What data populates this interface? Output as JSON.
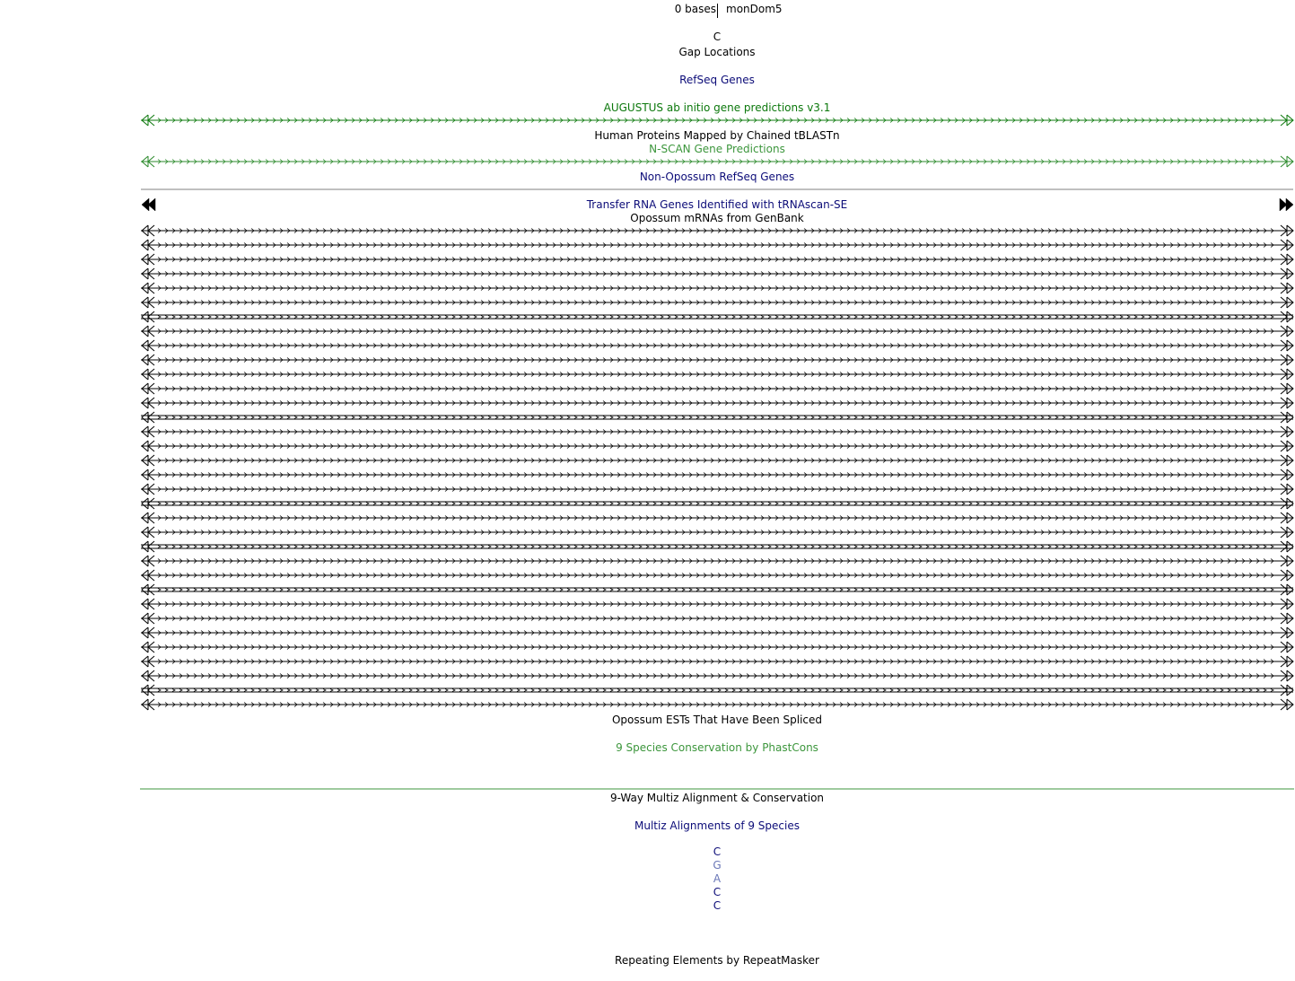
{
  "ruler": {
    "left_label": "0 bases",
    "right_label": "monDom5"
  },
  "base_top": "C",
  "tracks": {
    "gap": "Gap Locations",
    "refseq": "RefSeq Genes",
    "augustus": "AUGUSTUS ab initio gene predictions v3.1",
    "human_proteins": "Human Proteins Mapped by Chained tBLASTn",
    "nscan": "N-SCAN Gene Predictions",
    "nonopossum_refseq": "Non-Opossum RefSeq Genes",
    "trna": "Transfer RNA Genes Identified with tRNAscan-SE",
    "mrna": "Opossum mRNAs from GenBank",
    "est": "Opossum ESTs That Have Been Spliced",
    "phastcons": "9 Species Conservation by PhastCons",
    "multiz_cons": "9-Way Multiz Alignment & Conservation",
    "multiz_align": "Multiz Alignments of 9 Species",
    "repeatmasker": "Repeating Elements by RepeatMasker"
  },
  "multiz_bases": [
    "C",
    "G",
    "A",
    "C",
    "C"
  ],
  "colors": {
    "black": "#000000",
    "navy": "#0c0c78",
    "green": "#0c780c",
    "light_green": "#3c963c",
    "mid_green": "#2b8a2b",
    "light_blue": "#6a77b7",
    "gray": "#808080"
  },
  "mrna_features": {
    "count": 34,
    "double_rows": [
      6,
      13,
      19,
      22,
      25,
      32
    ]
  }
}
